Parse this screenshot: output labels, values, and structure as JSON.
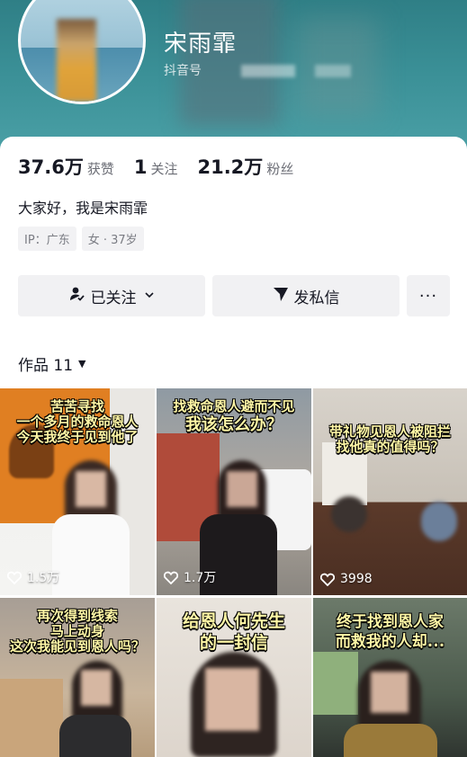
{
  "profile": {
    "nickname": "宋雨霏",
    "douyin_label": "抖音号",
    "stats": [
      {
        "value": "37.6万",
        "label": "获赞"
      },
      {
        "value": "1",
        "label": "关注"
      },
      {
        "value": "21.2万",
        "label": "粉丝"
      }
    ],
    "bio": "大家好，我是宋雨霏",
    "tags": [
      "IP：广东",
      "女 · 37岁"
    ]
  },
  "actions": {
    "follow_label": "已关注",
    "message_label": "发私信",
    "more_label": "···"
  },
  "works": {
    "label": "作品 11"
  },
  "videos": [
    {
      "caption": [
        "苦苦寻找",
        "一个多月的救命恩人",
        "今天我终于见到他了"
      ],
      "likes": "1.5万"
    },
    {
      "caption": [
        "找救命恩人避而不见",
        "我该怎么办？"
      ],
      "likes": "1.7万"
    },
    {
      "caption": [
        "带礼物见恩人被阻拦",
        "找他真的值得吗？"
      ],
      "likes": "3998"
    },
    {
      "caption": [
        "再次得到线索",
        "马上动身",
        "这次我能见到恩人吗？"
      ],
      "likes": ""
    },
    {
      "caption": [
        "给恩人何先生",
        "的一封信"
      ],
      "likes": ""
    },
    {
      "caption": [
        "终于找到恩人家",
        "而救我的人却..."
      ],
      "likes": ""
    }
  ],
  "icons": {
    "follow": "user-check-icon",
    "message": "send-icon",
    "like": "heart-outline-icon"
  }
}
